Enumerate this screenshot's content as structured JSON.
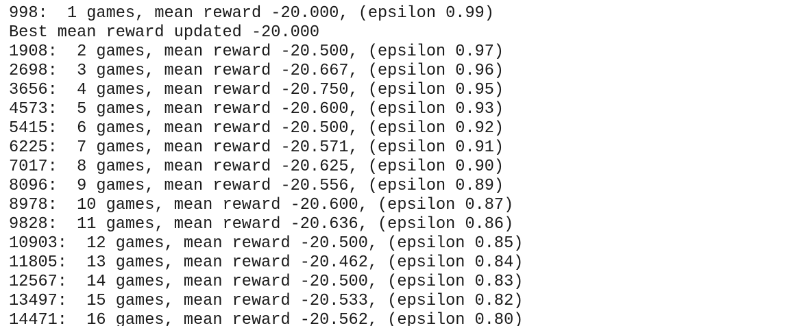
{
  "output": {
    "lines": [
      "998:  1 games, mean reward -20.000, (epsilon 0.99)",
      "Best mean reward updated -20.000",
      "1908:  2 games, mean reward -20.500, (epsilon 0.97)",
      "2698:  3 games, mean reward -20.667, (epsilon 0.96)",
      "3656:  4 games, mean reward -20.750, (epsilon 0.95)",
      "4573:  5 games, mean reward -20.600, (epsilon 0.93)",
      "5415:  6 games, mean reward -20.500, (epsilon 0.92)",
      "6225:  7 games, mean reward -20.571, (epsilon 0.91)",
      "7017:  8 games, mean reward -20.625, (epsilon 0.90)",
      "8096:  9 games, mean reward -20.556, (epsilon 0.89)",
      "8978:  10 games, mean reward -20.600, (epsilon 0.87)",
      "9828:  11 games, mean reward -20.636, (epsilon 0.86)",
      "10903:  12 games, mean reward -20.500, (epsilon 0.85)",
      "11805:  13 games, mean reward -20.462, (epsilon 0.84)",
      "12567:  14 games, mean reward -20.500, (epsilon 0.83)",
      "13497:  15 games, mean reward -20.533, (epsilon 0.82)",
      "14471:  16 games, mean reward -20.562, (epsilon 0.80)"
    ]
  }
}
